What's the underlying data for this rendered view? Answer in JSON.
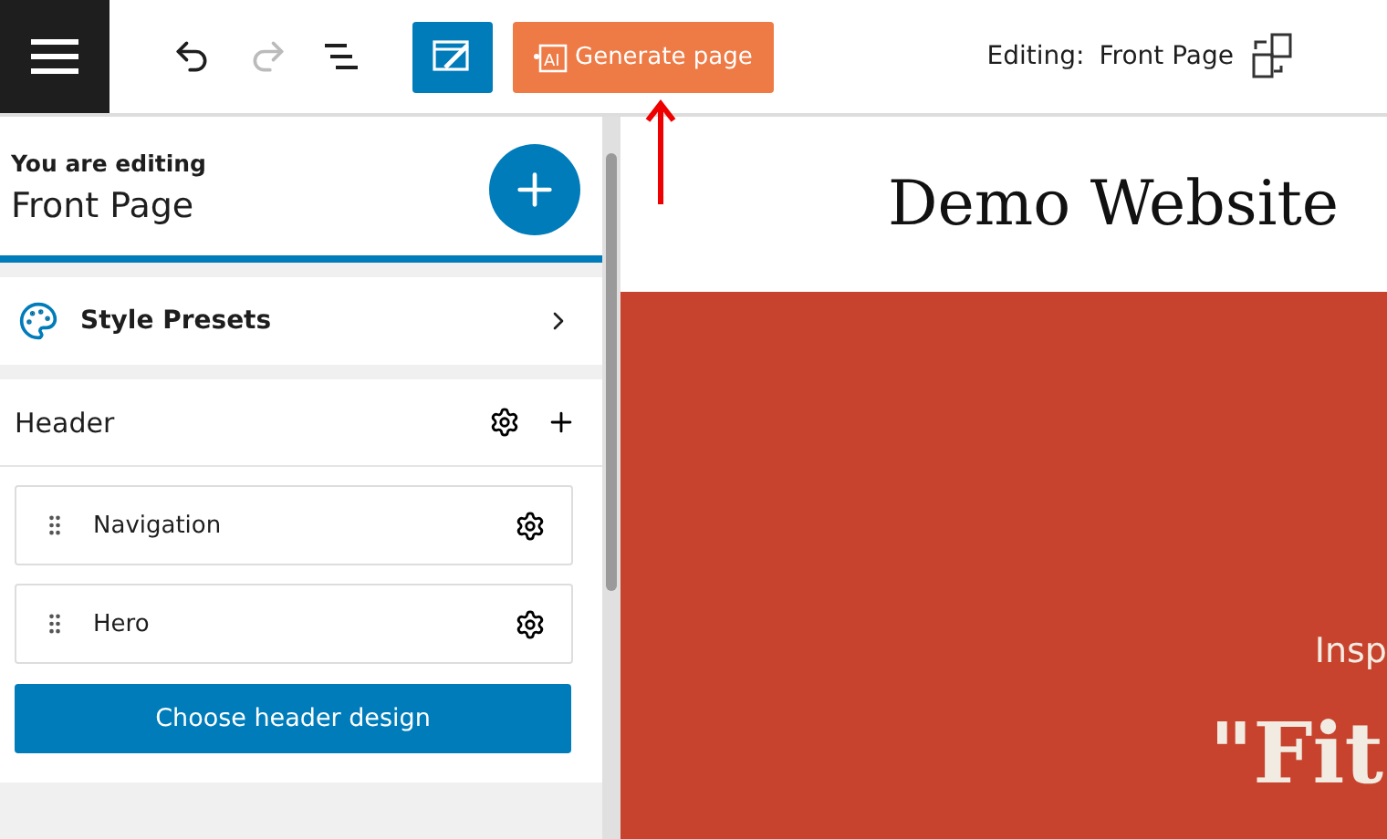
{
  "toolbar": {
    "ai_badge": "AI",
    "generate_button": "Generate page",
    "editing_label": "Editing:",
    "editing_page": "Front Page"
  },
  "sidebar": {
    "caption": "You are editing",
    "page_title": "Front Page",
    "style_presets": "Style Presets",
    "section": {
      "title": "Header",
      "items": [
        {
          "label": "Navigation"
        },
        {
          "label": "Hero"
        }
      ],
      "button": "Choose header design"
    }
  },
  "preview": {
    "site_title": "Demo Website",
    "hero_kicker": "Insp",
    "hero_heading": "\"Fit"
  }
}
